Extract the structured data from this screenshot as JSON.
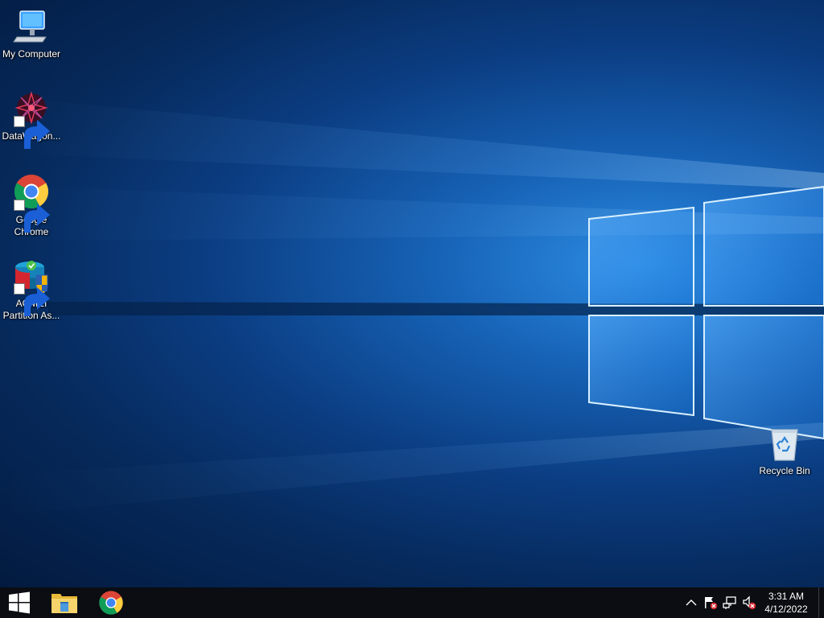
{
  "desktop": {
    "icons": [
      {
        "label": "My Computer",
        "icon": "my-computer-icon",
        "shortcut": false
      },
      {
        "label": "DataWagon...",
        "icon": "datawagon-icon",
        "shortcut": true
      },
      {
        "label": "Google Chrome",
        "icon": "chrome-icon",
        "shortcut": true
      },
      {
        "label": "AOMEI Partition As...",
        "icon": "aomei-partition-assistant-icon",
        "shortcut": true
      },
      {
        "label": "Recycle Bin",
        "icon": "recycle-bin-icon",
        "shortcut": false
      }
    ]
  },
  "taskbar": {
    "pinned": [
      {
        "icon": "windows-start-icon"
      },
      {
        "icon": "file-explorer-icon"
      },
      {
        "icon": "chrome-icon"
      }
    ],
    "tray": {
      "icons": [
        "chevron-up-icon",
        "action-center-flag-icon",
        "network-icon",
        "speaker-muted-icon"
      ],
      "time": "3:31 AM",
      "date": "4/12/2022"
    }
  },
  "colors": {
    "wallpaper_accent": "#2d8de3",
    "taskbar": "#0b0d12"
  }
}
